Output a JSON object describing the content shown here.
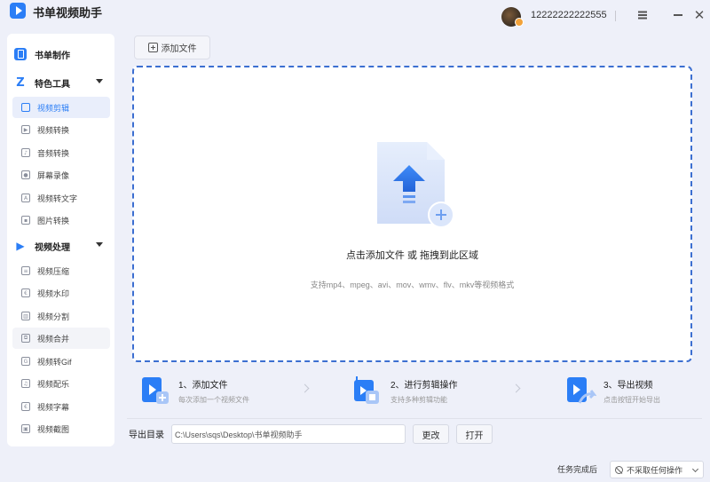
{
  "app": {
    "title": "书单视频助手"
  },
  "user": {
    "phone": "12222222222555"
  },
  "sidebar": {
    "sections": [
      {
        "label": "书单制作",
        "icon": "book-icon"
      },
      {
        "label": "特色工具",
        "icon": "z-icon"
      },
      {
        "label": "视频处理",
        "icon": "video-icon"
      }
    ],
    "tools": [
      {
        "label": "视频剪辑",
        "icon": "crop-icon"
      },
      {
        "label": "视频转换",
        "icon": "video-convert-icon"
      },
      {
        "label": "音频转换",
        "icon": "audio-icon"
      },
      {
        "label": "屏幕录像",
        "icon": "record-icon"
      },
      {
        "label": "视频转文字",
        "icon": "text-icon"
      },
      {
        "label": "图片转换",
        "icon": "image-icon"
      }
    ],
    "video": [
      {
        "label": "视频压缩",
        "icon": "compress-icon"
      },
      {
        "label": "视频水印",
        "icon": "watermark-icon"
      },
      {
        "label": "视频分割",
        "icon": "split-icon"
      },
      {
        "label": "视频合并",
        "icon": "merge-icon"
      },
      {
        "label": "视频转Gif",
        "icon": "gif-icon"
      },
      {
        "label": "视频配乐",
        "icon": "music-icon"
      },
      {
        "label": "视频字幕",
        "icon": "subtitle-icon"
      },
      {
        "label": "视频截图",
        "icon": "screenshot-icon"
      }
    ]
  },
  "toolbar": {
    "add_file": "添加文件"
  },
  "dropzone": {
    "main": "点击添加文件 或 拖拽到此区域",
    "sub": "支持mp4、mpeg、avi、mov、wmv、flv、mkv等视频格式"
  },
  "steps": [
    {
      "title": "1、添加文件",
      "sub": "每次添加一个视频文件"
    },
    {
      "title": "2、进行剪辑操作",
      "sub": "支持多种剪辑功能"
    },
    {
      "title": "3、导出视频",
      "sub": "点击按钮开始导出"
    }
  ],
  "export": {
    "label": "导出目录",
    "path": "C:\\Users\\sqs\\Desktop\\书单视频助手",
    "change": "更改",
    "open": "打开"
  },
  "footer": {
    "label": "任务完成后",
    "option": "不采取任何操作"
  },
  "colors": {
    "accent": "#2b7ef6",
    "dash_border": "#3c6fd1",
    "background": "#eef0f9"
  }
}
